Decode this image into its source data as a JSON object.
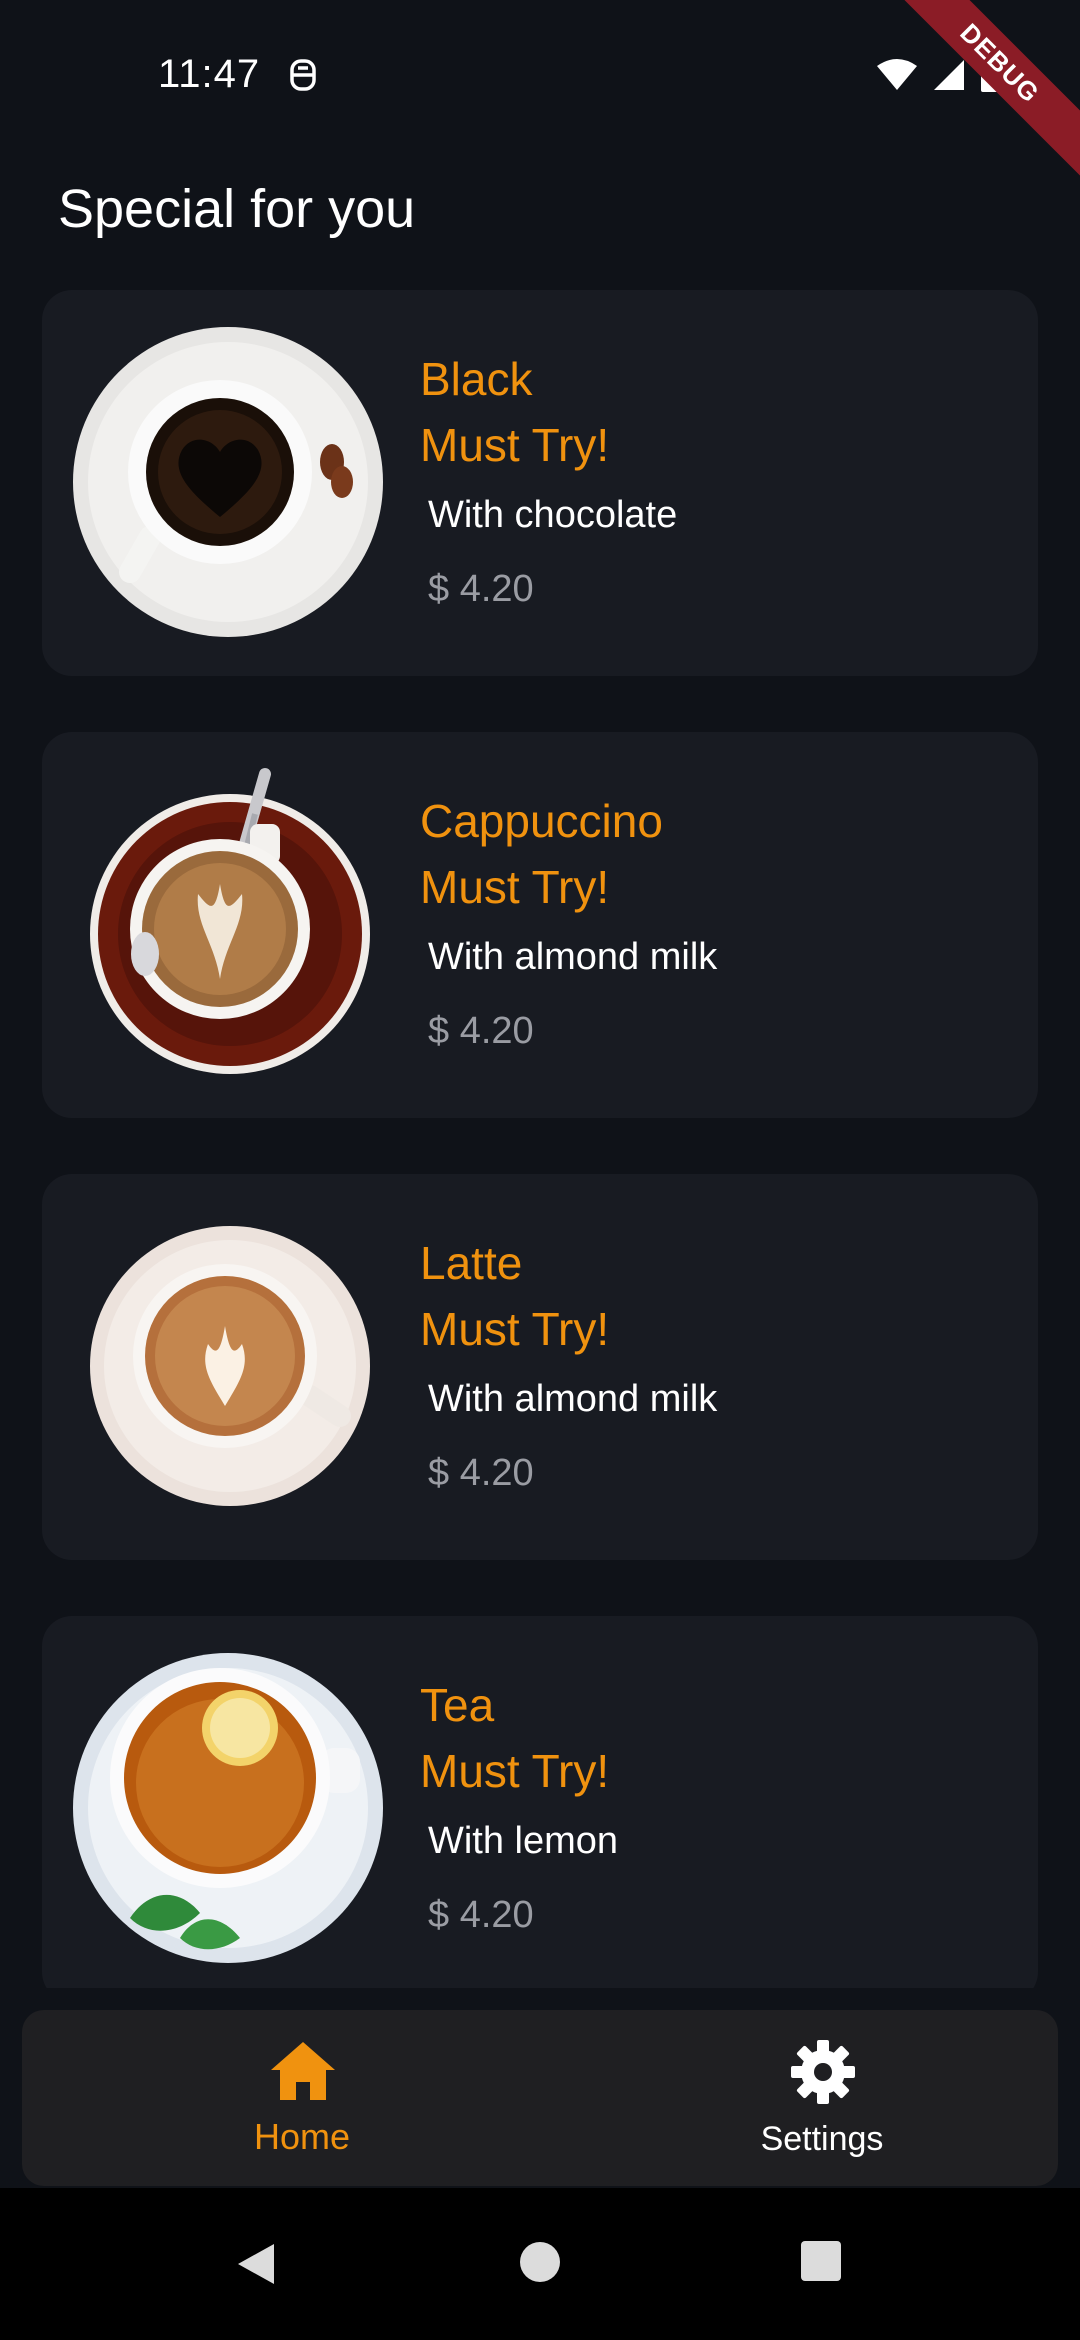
{
  "status_bar": {
    "time": "11:47",
    "debug_label": "DEBUG",
    "icons": [
      "sim-icon",
      "wifi-icon",
      "signal-icon",
      "battery-icon"
    ]
  },
  "page": {
    "title": "Special for you"
  },
  "cards": [
    {
      "name": "Black",
      "tag": "Must Try!",
      "description": "With chocolate",
      "price": "$ 4.20",
      "image": "black-coffee-cup"
    },
    {
      "name": "Cappuccino",
      "tag": "Must Try!",
      "description": "With almond milk",
      "price": "$ 4.20",
      "image": "cappuccino-cup"
    },
    {
      "name": "Latte",
      "tag": "Must Try!",
      "description": "With almond milk",
      "price": "$ 4.20",
      "image": "latte-cup"
    },
    {
      "name": "Tea",
      "tag": "Must Try!",
      "description": "With lemon",
      "price": "$ 4.20",
      "image": "lemon-tea-cup"
    }
  ],
  "bottom_nav": {
    "items": [
      {
        "label": "Home",
        "icon": "home-icon",
        "active": true
      },
      {
        "label": "Settings",
        "icon": "gear-icon",
        "active": false
      }
    ]
  },
  "colors": {
    "background": "#0f1218",
    "card": "#181b22",
    "accent": "#f0920f",
    "price": "#9a9ca3",
    "nav_bg": "#1f1f22"
  }
}
